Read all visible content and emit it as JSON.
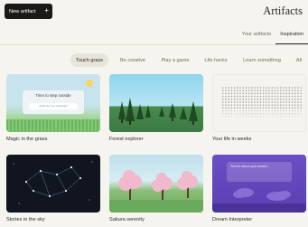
{
  "header": {
    "new_artifact_label": "New artifact",
    "new_artifact_icon": "plus-icon",
    "title": "Artifacts",
    "tabs": [
      {
        "label": "Your artifacts",
        "active": false
      },
      {
        "label": "Inspiration",
        "active": true
      }
    ]
  },
  "filters": [
    {
      "label": "Touch grass",
      "active": true
    },
    {
      "label": "Be creative",
      "active": false
    },
    {
      "label": "Play a game",
      "active": false
    },
    {
      "label": "Life hacks",
      "active": false
    },
    {
      "label": "Learn something",
      "active": false
    },
    {
      "label": "All",
      "active": false
    }
  ],
  "cards": [
    {
      "title": "Magic in the grass",
      "thumb_heading": "Time to step outside",
      "thumb_input": "where are you exploring?"
    },
    {
      "title": "Forest explorer"
    },
    {
      "title": "Your life in weeks"
    },
    {
      "title": "Stories in the sky"
    },
    {
      "title": "Sakura serenity"
    },
    {
      "title": "Dream Interpreter",
      "thumb_heading": "Tell me about your dream..."
    }
  ],
  "colors": {
    "background": "#f5f4ee",
    "primary_button": "#1b1a17",
    "active_chip": "#e7e4da",
    "dream_purple": "#5a3fb3"
  }
}
